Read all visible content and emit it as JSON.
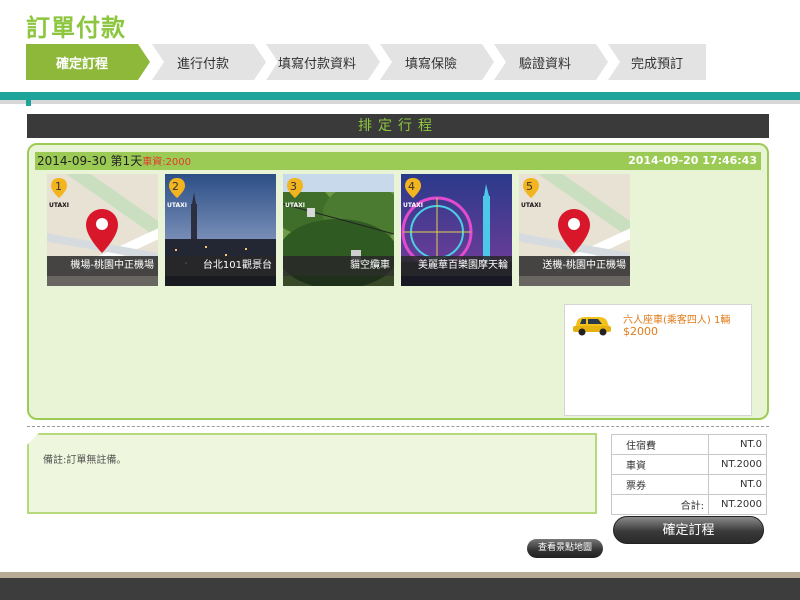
{
  "page_title": "訂單付款",
  "steps": [
    "確定訂程",
    "進行付款",
    "填寫付款資料",
    "填寫保險",
    "驗證資料",
    "完成預訂"
  ],
  "section_title": "排定行程",
  "day": {
    "date_label": "2014-09-30 第1天",
    "fee_label": "車資:2000",
    "timestamp": "2014-09-20 17:46:43"
  },
  "spots": [
    {
      "num": "1",
      "caption": "機場-桃園中正機場",
      "icon": "map-pin-icon",
      "brand": "UTAXI"
    },
    {
      "num": "2",
      "caption": "台北101觀景台",
      "icon": "photo",
      "brand": "UTAXI"
    },
    {
      "num": "3",
      "caption": "貓空纜車",
      "icon": "photo",
      "brand": "UTAXI"
    },
    {
      "num": "4",
      "caption": "美麗華百樂園摩天輪",
      "icon": "photo",
      "brand": "UTAXI"
    },
    {
      "num": "5",
      "caption": "送機-桃園中正機場",
      "icon": "map-pin-icon",
      "brand": "UTAXI"
    }
  ],
  "taxi": {
    "name": "六人座車(乘客四人) 1輛",
    "price": "$2000"
  },
  "note": "備註:訂單無註備。",
  "costs": [
    {
      "label": "住宿費",
      "value": "NT.0"
    },
    {
      "label": "車資",
      "value": "NT.2000"
    },
    {
      "label": "票券",
      "value": "NT.0"
    },
    {
      "label": "合計:",
      "value": "NT.2000"
    }
  ],
  "buttons": {
    "confirm": "確定訂程",
    "view_map": "查看景點地圖"
  },
  "colors": {
    "accent_green": "#8db83a",
    "teal": "#1fa49a",
    "panel_bg": "#e9f3d5",
    "fee_red": "#e03a2a",
    "taxi_orange": "#e07b1a"
  }
}
